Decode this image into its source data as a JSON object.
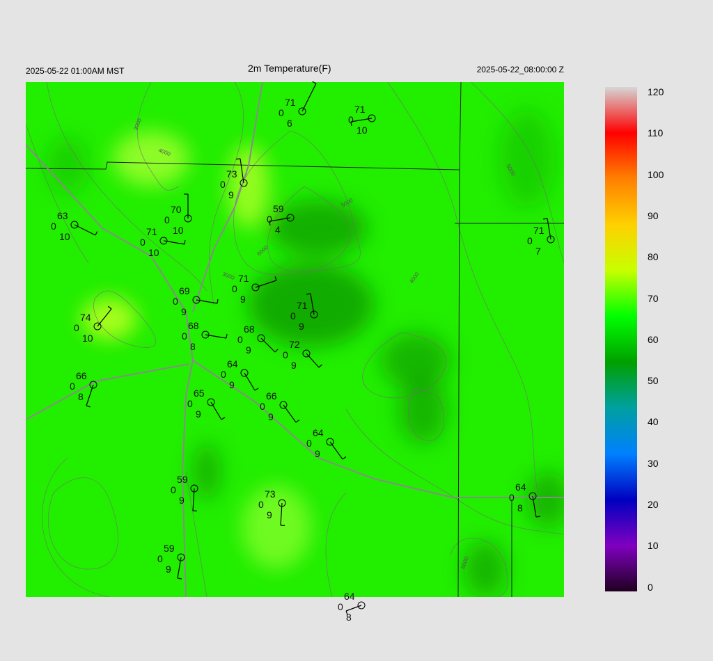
{
  "header": {
    "left": "2025-05-22 01:00AM MST",
    "title": "2m Temperature(F)",
    "right": "2025-05-22_08:00:00 Z"
  },
  "colorbar": {
    "ticks": [
      "120",
      "110",
      "100",
      "90",
      "80",
      "70",
      "60",
      "50",
      "40",
      "30",
      "20",
      "10",
      "0"
    ],
    "stops": [
      "#d6d6d6",
      "#ff0000",
      "#ff8000",
      "#ffd000",
      "#c8ff00",
      "#00ff00",
      "#00a000",
      "#00a0a0",
      "#0080ff",
      "#0000c0",
      "#8000c0",
      "#200020"
    ]
  },
  "map": {
    "background": "#22ee00",
    "contour_labels": [
      "3000",
      "4000",
      "5000",
      "6000",
      "3000",
      "4000",
      "5000",
      "6000"
    ],
    "stations": [
      {
        "t": "71",
        "v": "0",
        "d": "6"
      },
      {
        "t": "71",
        "v": "0",
        "d": "10"
      },
      {
        "t": "73",
        "v": "0",
        "d": "9"
      },
      {
        "t": "59",
        "v": "0",
        "d": "4"
      },
      {
        "t": "70",
        "v": "0",
        "d": "10"
      },
      {
        "t": "63",
        "v": "0",
        "d": "10"
      },
      {
        "t": "71",
        "v": "0",
        "d": "10"
      },
      {
        "t": "71",
        "v": "0",
        "d": "7"
      },
      {
        "t": "71",
        "v": "0",
        "d": "9"
      },
      {
        "t": "69",
        "v": "0",
        "d": "9"
      },
      {
        "t": "71",
        "v": "0",
        "d": "9"
      },
      {
        "t": "74",
        "v": "0",
        "d": "10"
      },
      {
        "t": "68",
        "v": "0",
        "d": "8"
      },
      {
        "t": "68",
        "v": "0",
        "d": "9"
      },
      {
        "t": "72",
        "v": "0",
        "d": "9"
      },
      {
        "t": "66",
        "v": "0",
        "d": "8"
      },
      {
        "t": "64",
        "v": "0",
        "d": "9"
      },
      {
        "t": "65",
        "v": "0",
        "d": "9"
      },
      {
        "t": "66",
        "v": "0",
        "d": "9"
      },
      {
        "t": "64",
        "v": "0",
        "d": "9"
      },
      {
        "t": "59",
        "v": "0",
        "d": "9"
      },
      {
        "t": "73",
        "v": "0",
        "d": "9"
      },
      {
        "t": "64",
        "v": "0",
        "d": "8"
      },
      {
        "t": "59",
        "v": "0",
        "d": "9"
      },
      {
        "t": "64",
        "v": "0",
        "d": "8"
      }
    ]
  }
}
